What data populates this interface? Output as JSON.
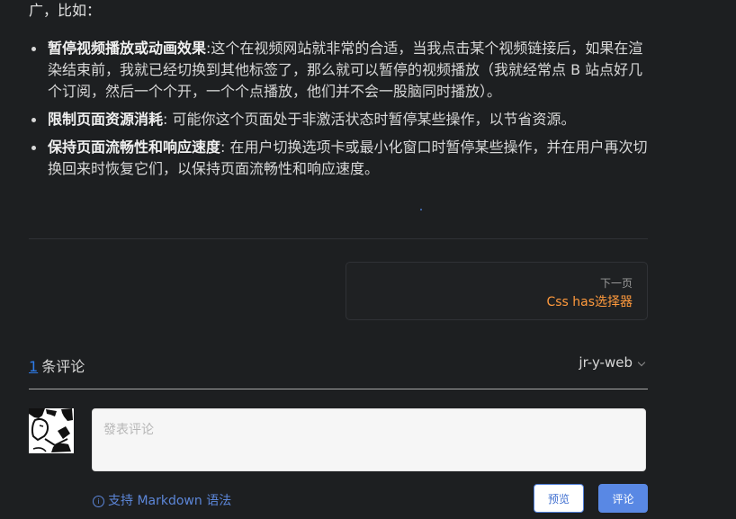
{
  "article": {
    "intro": "广，比如：",
    "bullets": [
      {
        "title": "暂停视频播放或动画效果",
        "text": ":这个在视频网站就非常的合适，当我点击某个视频链接后，如果在渲染结束前，我就已经切换到其他标签了，那么就可以暂停的视频播放（我就经常点 B 站点好几个订阅，然后一个个开，一个个点播放，他们并不会一股脑同时播放）。"
      },
      {
        "title": "限制页面资源消耗",
        "text": ": 可能你这个页面处于非激活状态时暂停某些操作，以节省资源。"
      },
      {
        "title": "保持页面流畅性和响应速度",
        "text": ": 在用户切换选项卡或最小化窗口时暂停某些操作，并在用户再次切换回来时恢复它们，以保持页面流畅性和响应速度。"
      }
    ]
  },
  "navigation": {
    "next_label": "下一页",
    "next_title": "Css has选择器"
  },
  "comments": {
    "count": "1",
    "count_label": "条评论",
    "user": "jr-y-web",
    "placeholder": "發表评论",
    "markdown_tip": "支持 Markdown 语法",
    "preview_button": "预览",
    "submit_button": "评论"
  },
  "icons": {
    "chevron": "chevron-down-icon",
    "info": "info-icon"
  },
  "colors": {
    "accent_orange": "#ff9a3d",
    "link_blue": "#2d7be8",
    "button_blue": "#5988e4",
    "background": "#1d1f21"
  }
}
